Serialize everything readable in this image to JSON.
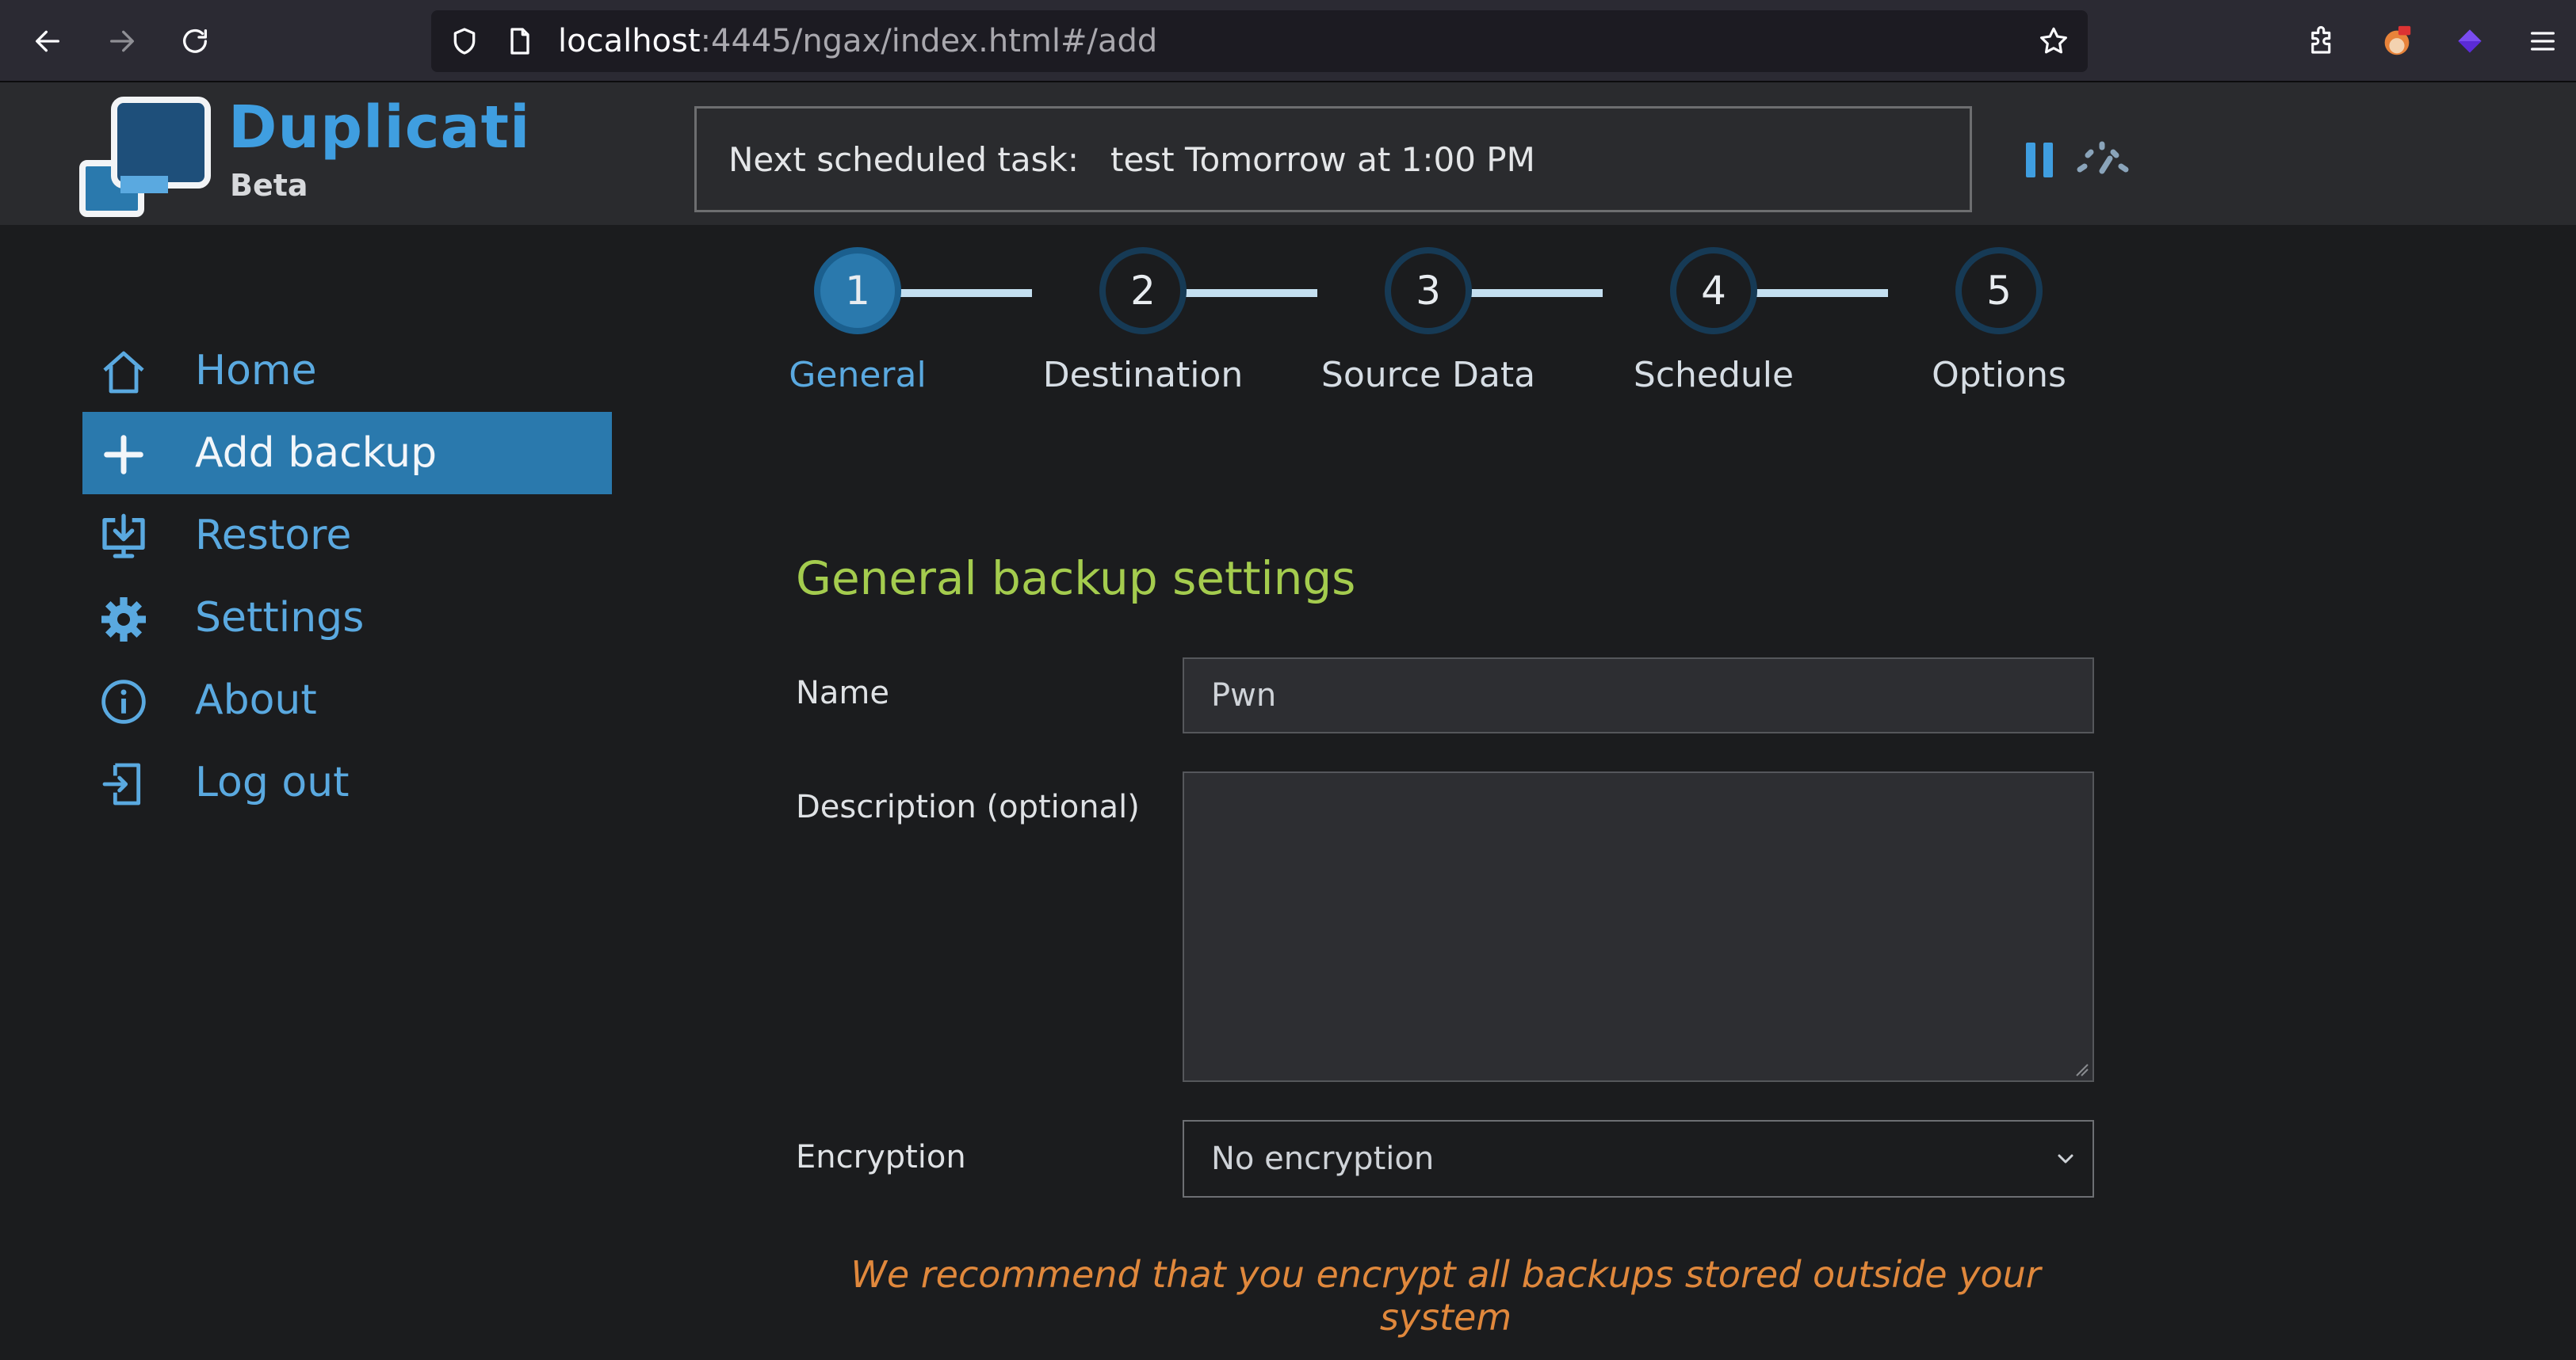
{
  "browser": {
    "url_host": "localhost",
    "url_rest": ":4445/ngax/index.html#/add"
  },
  "header": {
    "brand": "Duplicati",
    "brand_sub": "Beta",
    "schedule_label": "Next scheduled task:",
    "schedule_value": "test Tomorrow at 1:00 PM"
  },
  "sidebar": {
    "items": [
      {
        "label": "Home",
        "icon": "home-icon",
        "active": false
      },
      {
        "label": "Add backup",
        "icon": "plus-icon",
        "active": true
      },
      {
        "label": "Restore",
        "icon": "restore-icon",
        "active": false
      },
      {
        "label": "Settings",
        "icon": "gear-icon",
        "active": false
      },
      {
        "label": "About",
        "icon": "info-icon",
        "active": false
      },
      {
        "label": "Log out",
        "icon": "logout-icon",
        "active": false
      }
    ]
  },
  "wizard": {
    "steps": [
      {
        "number": "1",
        "label": "General",
        "active": true
      },
      {
        "number": "2",
        "label": "Destination",
        "active": false
      },
      {
        "number": "3",
        "label": "Source Data",
        "active": false
      },
      {
        "number": "4",
        "label": "Schedule",
        "active": false
      },
      {
        "number": "5",
        "label": "Options",
        "active": false
      }
    ]
  },
  "form": {
    "title": "General backup settings",
    "name_label": "Name",
    "name_value": "Pwn",
    "description_label": "Description (optional)",
    "description_value": "",
    "encryption_label": "Encryption",
    "encryption_value": "No encryption",
    "warning": "We recommend that you encrypt all backups stored outside your system"
  },
  "colors": {
    "accent": "#2a79ad",
    "link": "#5aa9e0",
    "title_green": "#a4cc4e",
    "warning_orange": "#e0883c"
  }
}
